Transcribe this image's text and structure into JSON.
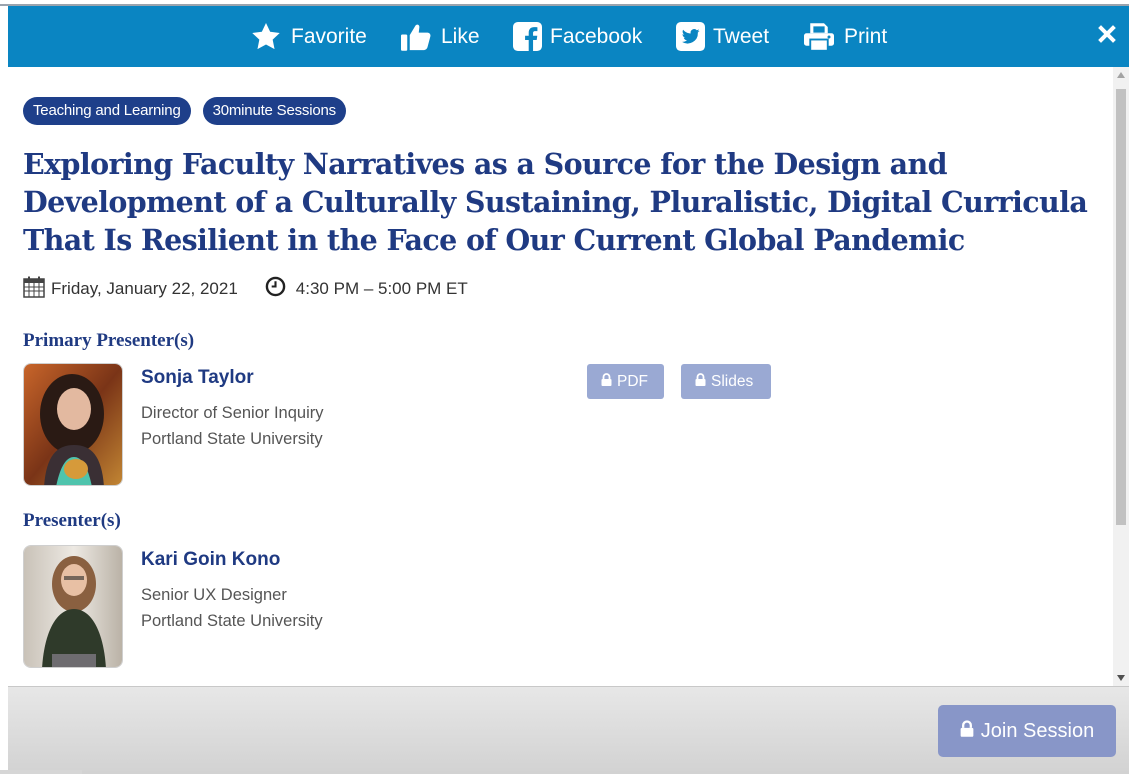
{
  "toolbar": {
    "items": [
      {
        "label": "Favorite",
        "icon": "star-icon"
      },
      {
        "label": "Like",
        "icon": "thumbs-up-icon"
      },
      {
        "label": "Facebook",
        "icon": "facebook-icon"
      },
      {
        "label": "Tweet",
        "icon": "twitter-icon"
      },
      {
        "label": "Print",
        "icon": "print-icon"
      }
    ],
    "close_icon": "close-icon",
    "color": "#0a85c2"
  },
  "session": {
    "tags": [
      "Teaching and Learning",
      "30minute Sessions"
    ],
    "title": "Exploring Faculty Narratives as a Source for the Design and Development of a Culturally Sustaining, Pluralistic, Digital Curricula That Is Resilient in the Face of Our Current Global Pandemic",
    "date": "Friday, January 22, 2021",
    "time": "4:30 PM – 5:00 PM ET"
  },
  "primary_presenters": {
    "heading": "Primary Presenter(s)",
    "people": [
      {
        "name": "Sonja Taylor",
        "role": "Director of Senior Inquiry",
        "org": "Portland State University"
      }
    ]
  },
  "presenters": {
    "heading": "Presenter(s)",
    "people": [
      {
        "name": "Kari Goin Kono",
        "role": "Senior UX Designer",
        "org": "Portland State University"
      }
    ]
  },
  "resources": {
    "pdf_label": "PDF",
    "slides_label": "Slides"
  },
  "footer": {
    "join_label": "Join Session"
  },
  "colors": {
    "accent": "#1f3a82",
    "tag_bg": "#1e3f8a",
    "disabled_button": "#9aa9d3"
  }
}
